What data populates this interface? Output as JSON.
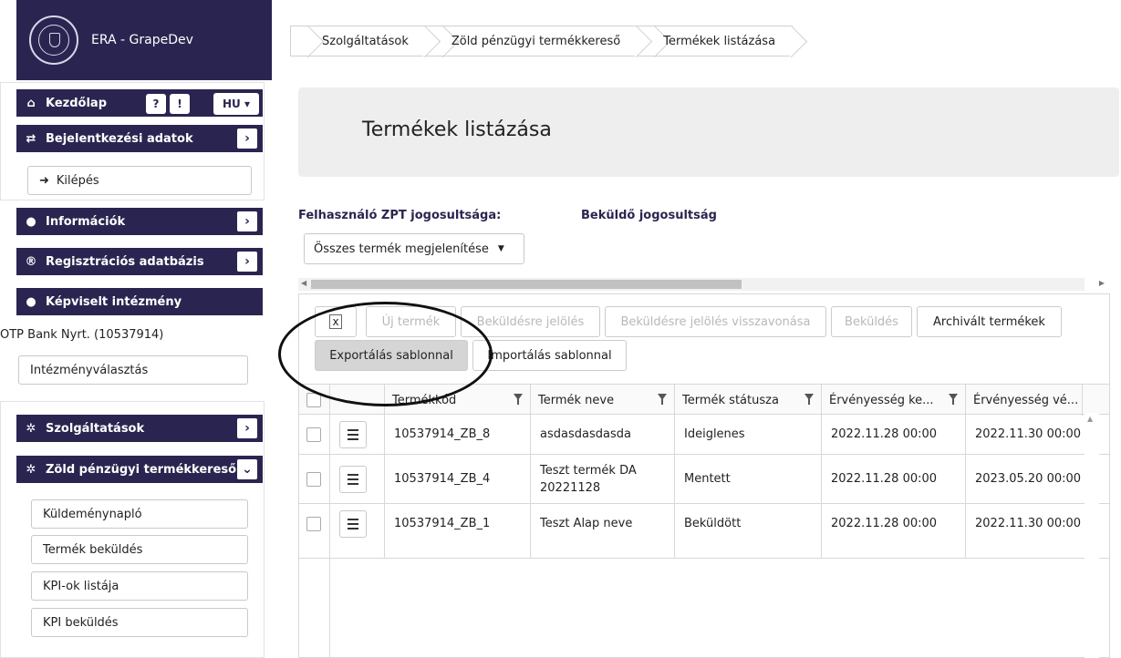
{
  "app": {
    "title": "ERA - GrapeDev"
  },
  "breadcrumb": [
    "Szolgáltatások",
    "Zöld pénzügyi termékkereső",
    "Termékek listázása"
  ],
  "sidebar": {
    "home": {
      "label": "Kezdőlap",
      "icon": "home-icon"
    },
    "help_icon": "?",
    "info_icon": "!",
    "lang": "HU ▾",
    "login_data": {
      "label": "Bejelentkezési adatok",
      "icon": "swap-icon"
    },
    "logout": {
      "label": "Kilépés",
      "icon": "logout-icon"
    },
    "info": {
      "label": "Információk",
      "icon": "globe-icon"
    },
    "registry": {
      "label": "Regisztrációs adatbázis",
      "icon": "registered-icon"
    },
    "institution": {
      "label": "Képviselt intézmény",
      "icon": "user-icon"
    },
    "institution_name": "OTP Bank Nyrt. (10537914)",
    "institution_select": "Intézményválasztás",
    "services": {
      "label": "Szolgáltatások",
      "icon": "gear-icon"
    },
    "green_search": {
      "label": "Zöld pénzügyi termékkereső",
      "icon": "gear-icon"
    },
    "sub_items": [
      "Küldeménynapló",
      "Termék beküldés",
      "KPI-ok listája",
      "KPI beküldés"
    ]
  },
  "main": {
    "page_title": "Termékek listázása",
    "permission_label": "Felhasználó ZPT jogosultsága:",
    "permission_value": "Beküldő jogosultság",
    "filter_select": "Összes termék megjelenítése",
    "toolbar": {
      "excel_icon": "excel-icon",
      "new_product": "Új termék",
      "mark_for_submit": "Beküldésre jelölés",
      "revoke_mark": "Beküldésre jelölés visszavonása",
      "submit": "Beküldés",
      "archived": "Archivált termékek",
      "export": "Exportálás sablonnal",
      "import": "Importálás sablonnal"
    },
    "columns": [
      "Termékkód",
      "Termék neve",
      "Termék státusza",
      "Érvényesség ke...",
      "Érvényesség vé..."
    ],
    "rows": [
      {
        "code": "10537914_ZB_8",
        "name": "asdasdasdasda",
        "status": "Ideiglenes",
        "valid_from": "2022.11.28 00:00",
        "valid_to": "2022.11.30 00:00"
      },
      {
        "code": "10537914_ZB_4",
        "name": "Teszt termék DA 20221128",
        "status": "Mentett",
        "valid_from": "2022.11.28 00:00",
        "valid_to": "2023.05.20 00:00"
      },
      {
        "code": "10537914_ZB_1",
        "name": "Teszt Alap neve",
        "status": "Beküldött",
        "valid_from": "2022.11.28 00:00",
        "valid_to": "2022.11.30 00:00"
      }
    ]
  },
  "colors": {
    "navy": "#2a2550",
    "panel_bg": "#eeeeee",
    "border": "#d8d8d8"
  }
}
